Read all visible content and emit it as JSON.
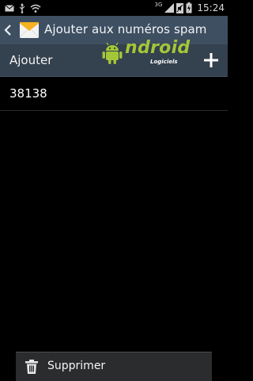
{
  "status_bar": {
    "time": "15:24",
    "network_type": "3G",
    "left_icons": [
      "mail-icon",
      "usb-icon",
      "wifi-icon"
    ],
    "right_icons": [
      "signal-icon",
      "mute-icon",
      "battery-icon"
    ]
  },
  "action_bar": {
    "title": "Ajouter aux numéros spam",
    "back_icon": "chevron-left-icon",
    "app_icon": "envelope-icon"
  },
  "add_row": {
    "label": "Ajouter",
    "add_icon": "plus-icon"
  },
  "watermark": {
    "brand": "ndroid",
    "sub": "Logiciels"
  },
  "spam_numbers": [
    "38138"
  ],
  "bottom_menu": {
    "delete_label": "Supprimer",
    "icon": "trash-icon"
  },
  "colors": {
    "action_bar": "#3e4f61",
    "add_row": "#34414e",
    "background": "#000000",
    "logo_green": "#a4c639"
  }
}
